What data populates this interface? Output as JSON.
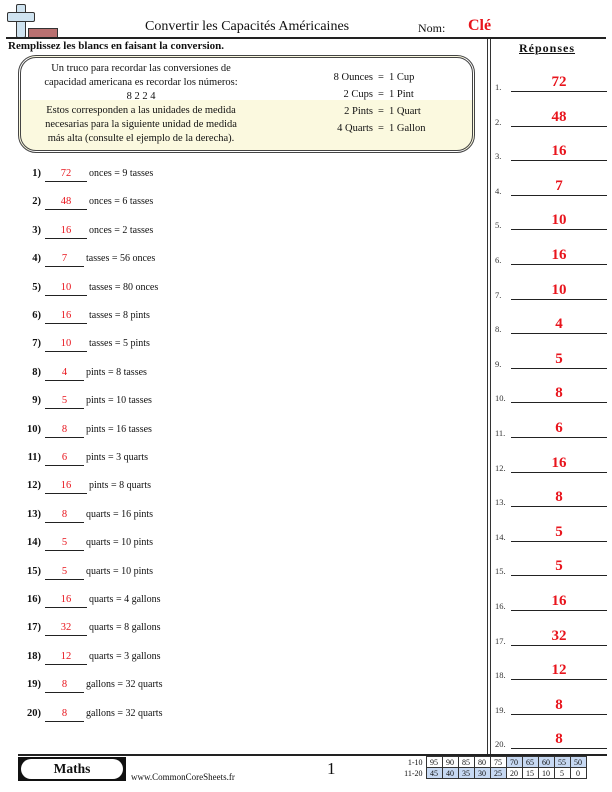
{
  "header": {
    "logo_icon": "plus-minus-logo-icon",
    "title": "Convertir les Capacités Américaines",
    "name_label": "Nom:",
    "name_value": "Clé"
  },
  "instructions": "Remplissez les blancs en faisant la conversion.",
  "tip": {
    "lines": [
      "Un truco para recordar las conversiones de",
      "capacidad americana es recordar los números:",
      "8 2 2 4",
      "Estos corresponden a las unidades de medida",
      "necesarias para la siguiente unidad de medida",
      "más alta (consulte el ejemplo de la derecha)."
    ],
    "conversions": [
      {
        "left": "8 Ounces",
        "eq": "=",
        "right": "1 Cup"
      },
      {
        "left": "2 Cups",
        "eq": "=",
        "right": "1 Pint"
      },
      {
        "left": "2 Pints",
        "eq": "=",
        "right": "1 Quart"
      },
      {
        "left": "4 Quarts",
        "eq": "=",
        "right": "1 Gallon"
      }
    ]
  },
  "problems": [
    {
      "num": "1)",
      "answer": "72",
      "text": "onces = 9 tasses"
    },
    {
      "num": "2)",
      "answer": "48",
      "text": "onces = 6 tasses"
    },
    {
      "num": "3)",
      "answer": "16",
      "text": "onces = 2 tasses"
    },
    {
      "num": "4)",
      "answer": "7",
      "text": "tasses = 56 onces"
    },
    {
      "num": "5)",
      "answer": "10",
      "text": "tasses = 80 onces"
    },
    {
      "num": "6)",
      "answer": "16",
      "text": "tasses = 8 pints"
    },
    {
      "num": "7)",
      "answer": "10",
      "text": "tasses = 5 pints"
    },
    {
      "num": "8)",
      "answer": "4",
      "text": "pints = 8 tasses"
    },
    {
      "num": "9)",
      "answer": "5",
      "text": "pints = 10 tasses"
    },
    {
      "num": "10)",
      "answer": "8",
      "text": "pints = 16 tasses"
    },
    {
      "num": "11)",
      "answer": "6",
      "text": "pints = 3 quarts"
    },
    {
      "num": "12)",
      "answer": "16",
      "text": "pints = 8 quarts"
    },
    {
      "num": "13)",
      "answer": "8",
      "text": "quarts = 16 pints"
    },
    {
      "num": "14)",
      "answer": "5",
      "text": "quarts = 10 pints"
    },
    {
      "num": "15)",
      "answer": "5",
      "text": "quarts = 10 pints"
    },
    {
      "num": "16)",
      "answer": "16",
      "text": "quarts = 4 gallons"
    },
    {
      "num": "17)",
      "answer": "32",
      "text": "quarts = 8 gallons"
    },
    {
      "num": "18)",
      "answer": "12",
      "text": "quarts = 3 gallons"
    },
    {
      "num": "19)",
      "answer": "8",
      "text": "gallons = 32 quarts"
    },
    {
      "num": "20)",
      "answer": "8",
      "text": "gallons = 32 quarts"
    }
  ],
  "answers": {
    "title": "Réponses",
    "items": [
      {
        "n": "1.",
        "v": "72"
      },
      {
        "n": "2.",
        "v": "48"
      },
      {
        "n": "3.",
        "v": "16"
      },
      {
        "n": "4.",
        "v": "7"
      },
      {
        "n": "5.",
        "v": "10"
      },
      {
        "n": "6.",
        "v": "16"
      },
      {
        "n": "7.",
        "v": "10"
      },
      {
        "n": "8.",
        "v": "4"
      },
      {
        "n": "9.",
        "v": "5"
      },
      {
        "n": "10.",
        "v": "8"
      },
      {
        "n": "11.",
        "v": "6"
      },
      {
        "n": "12.",
        "v": "16"
      },
      {
        "n": "13.",
        "v": "8"
      },
      {
        "n": "14.",
        "v": "5"
      },
      {
        "n": "15.",
        "v": "5"
      },
      {
        "n": "16.",
        "v": "16"
      },
      {
        "n": "17.",
        "v": "32"
      },
      {
        "n": "18.",
        "v": "12"
      },
      {
        "n": "19.",
        "v": "8"
      },
      {
        "n": "20.",
        "v": "8"
      }
    ]
  },
  "footer": {
    "badge": "Maths",
    "website": "www.CommonCoreSheets.fr",
    "page": "1",
    "score_rows": [
      {
        "label": "1-10",
        "cells": [
          "95",
          "90",
          "85",
          "80",
          "75",
          "70",
          "65",
          "60",
          "55",
          "50"
        ],
        "highlight": [
          false,
          false,
          false,
          false,
          false,
          true,
          true,
          true,
          true,
          true
        ]
      },
      {
        "label": "11-20",
        "cells": [
          "45",
          "40",
          "35",
          "30",
          "25",
          "20",
          "15",
          "10",
          "5",
          "0"
        ],
        "highlight": [
          true,
          true,
          true,
          true,
          true,
          false,
          false,
          false,
          false,
          false
        ]
      }
    ]
  },
  "colors": {
    "answer_red": "#e8141c",
    "tip_highlight": "#fbf9df",
    "score_highlight": "#c7d9f3"
  }
}
